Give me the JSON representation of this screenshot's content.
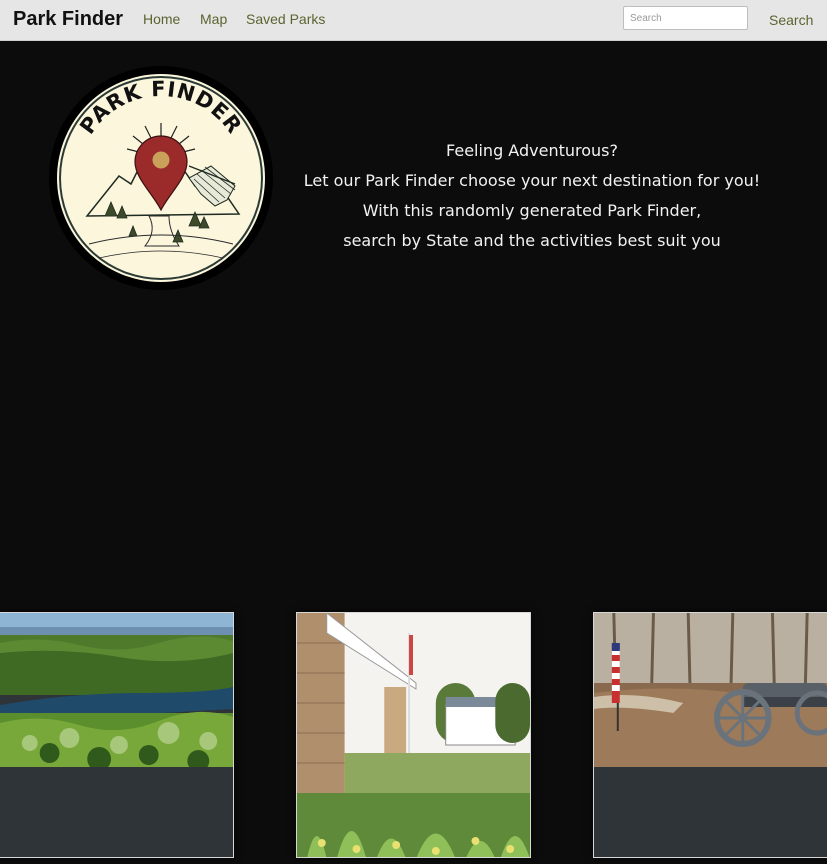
{
  "navbar": {
    "brand": "Park Finder",
    "links": [
      "Home",
      "Map",
      "Saved Parks"
    ],
    "search": {
      "placeholder": "Search",
      "value": "",
      "button_label": "Search"
    }
  },
  "hero": {
    "logo": {
      "text": "PARK FINDER",
      "icon": "map-pin-icon"
    },
    "tagline": [
      "Feeling Adventurous?",
      "Let our Park Finder choose your next destination for you!",
      "With this randomly generated Park Finder,",
      "search by State and the activities best suit you"
    ]
  },
  "cards": [
    {
      "image": "lake-forest-photo"
    },
    {
      "image": "fort-building-photo"
    },
    {
      "image": "cannon-flag-photo"
    }
  ],
  "colors": {
    "navbar_bg": "#e6e6e6",
    "nav_link": "#5a6430",
    "page_bg": "#0c0c0d",
    "card_body": "#2f3439",
    "logo_red": "#9b2a2a",
    "logo_cream": "#fbf6dc"
  }
}
